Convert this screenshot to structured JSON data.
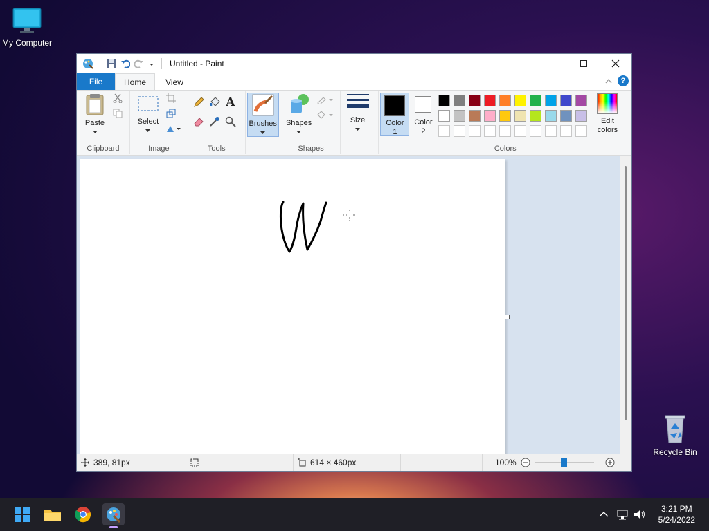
{
  "desktop": {
    "my_computer": "My Computer",
    "recycle_bin": "Recycle Bin"
  },
  "window": {
    "title": "Untitled - Paint"
  },
  "tabs": {
    "file": "File",
    "home": "Home",
    "view": "View"
  },
  "ribbon": {
    "clipboard": {
      "paste": "Paste",
      "label": "Clipboard"
    },
    "image": {
      "select": "Select",
      "label": "Image"
    },
    "tools": {
      "label": "Tools"
    },
    "brushes": {
      "label": "Brushes"
    },
    "shapes": {
      "button": "Shapes",
      "label": "Shapes"
    },
    "size": {
      "label": "Size"
    },
    "color1": {
      "line1": "Color",
      "line2": "1"
    },
    "color2": {
      "line1": "Color",
      "line2": "2"
    },
    "edit_colors": {
      "line1": "Edit",
      "line2": "colors"
    },
    "colors_label": "Colors",
    "palette_row1": [
      "#000000",
      "#7f7f7f",
      "#880015",
      "#ed1c24",
      "#ff7f27",
      "#fff200",
      "#22b14c",
      "#00a2e8",
      "#3f48cc",
      "#a349a4"
    ],
    "palette_row2": [
      "#ffffff",
      "#c3c3c3",
      "#b97a57",
      "#ffaec9",
      "#ffc90e",
      "#efe4b0",
      "#b5e61d",
      "#99d9ea",
      "#7092be",
      "#c8bfe7"
    ]
  },
  "status": {
    "cursor_pos": "389, 81px",
    "canvas_size": "614 × 460px",
    "zoom": "100%"
  },
  "taskbar": {
    "time": "3:21 PM",
    "date": "5/24/2022"
  }
}
